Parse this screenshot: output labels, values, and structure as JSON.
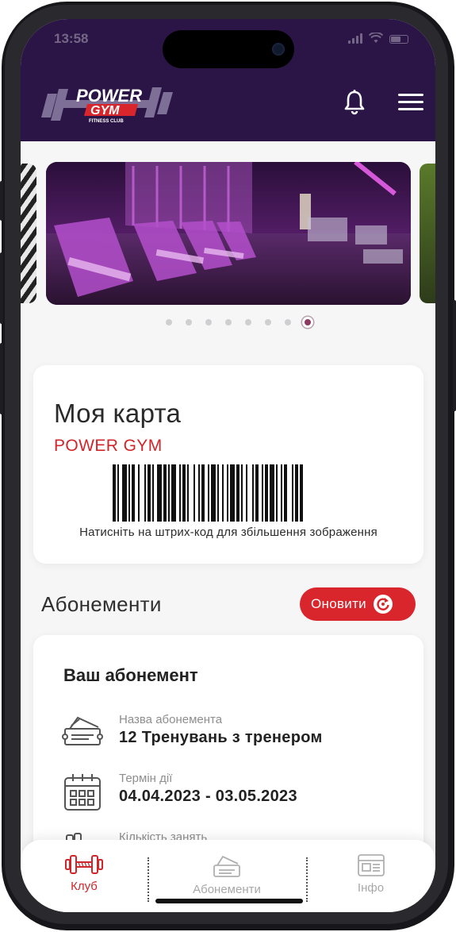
{
  "status": {
    "time": "13:58"
  },
  "header": {
    "logo_top": "POWER",
    "logo_mid": "GYM",
    "logo_bottom": "FITNESS CLUB"
  },
  "carousel": {
    "slides": 8,
    "active_index": 7
  },
  "my_card": {
    "title": "Моя карта",
    "club": "POWER GYM",
    "barcode_hint": "Натисніть на штрих-код для збільшення зображення"
  },
  "subscriptions": {
    "title": "Абонементи",
    "refresh_label": "Оновити",
    "card_title": "Ваш абонемент",
    "name_label": "Назва абонемента",
    "name_value": "12 Тренувань з тренером",
    "term_label": "Термін дії",
    "term_value": "04.04.2023 - 03.05.2023",
    "count_label": "Кількість занять"
  },
  "tabs": [
    {
      "label": "Клуб",
      "active": true
    },
    {
      "label": "Абонементи",
      "active": false
    },
    {
      "label": "Інфо",
      "active": false
    }
  ],
  "colors": {
    "header": "#2b1446",
    "accent": "#d9262c",
    "active_dot": "#8b3a62"
  }
}
